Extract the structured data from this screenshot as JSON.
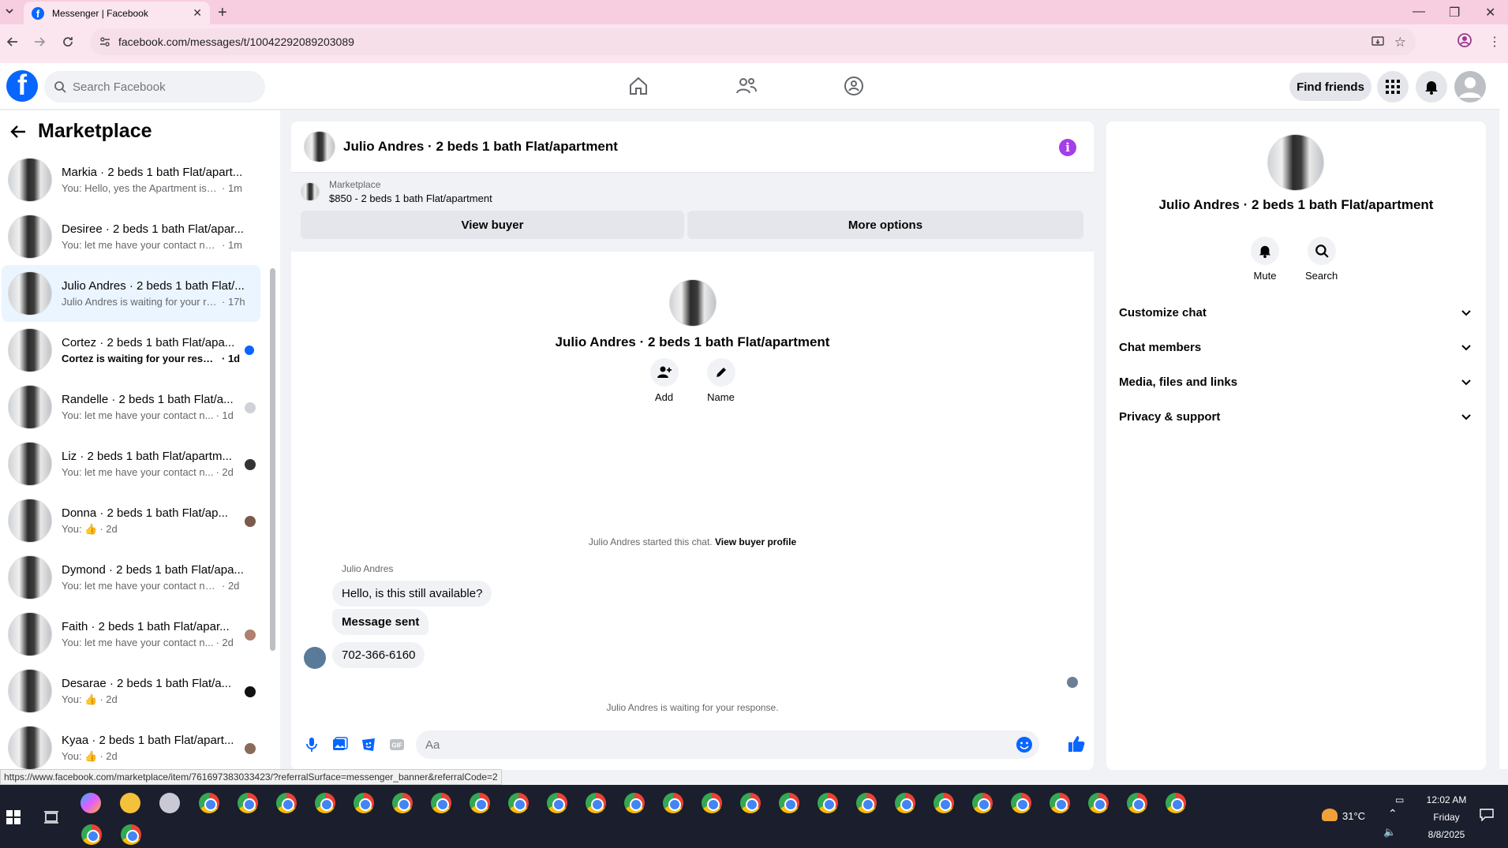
{
  "browser": {
    "tab_title": "Messenger | Facebook",
    "url": "facebook.com/messages/t/10042292089203089",
    "status_url": "https://www.facebook.com/marketplace/item/761697383033423/?referralSurface=messenger_banner&referralCode=2"
  },
  "fb_header": {
    "logo": "f",
    "search_placeholder": "Search Facebook",
    "find_friends": "Find friends"
  },
  "left_panel": {
    "title": "Marketplace",
    "conversations": [
      {
        "name": "Markia · 2 beds 1 bath Flat/apart...",
        "snippet": "You: Hello, yes the Apartment is sti...",
        "time": "· 1m",
        "mark": "none"
      },
      {
        "name": "Desiree · 2 beds 1 bath Flat/apar...",
        "snippet": "You: let me have your contact num...",
        "time": "· 1m",
        "mark": "none"
      },
      {
        "name": "Julio Andres · 2 beds 1 bath Flat/...",
        "snippet": "Julio Andres is waiting for your re...",
        "time": "· 17h",
        "mark": "none"
      },
      {
        "name": "Cortez · 2 beds 1 bath Flat/apa...",
        "snippet": "Cortez is waiting for your respo...",
        "time": "· 1d",
        "mark": "unread"
      },
      {
        "name": "Randelle · 2 beds 1 bath Flat/a...",
        "snippet": "You: let me have your contact n...",
        "time": "· 1d",
        "mark": "avatar"
      },
      {
        "name": "Liz · 2 beds 1 bath Flat/apartm...",
        "snippet": "You: let me have your contact n...",
        "time": "· 2d",
        "mark": "avatar"
      },
      {
        "name": "Donna · 2 beds 1 bath Flat/ap...",
        "snippet": "You: 👍",
        "time": "· 2d",
        "mark": "avatar"
      },
      {
        "name": "Dymond · 2 beds 1 bath Flat/apa...",
        "snippet": "You: let me have your contact num...",
        "time": "· 2d",
        "mark": "none"
      },
      {
        "name": "Faith · 2 beds 1 bath Flat/apar...",
        "snippet": "You: let me have your contact n...",
        "time": "· 2d",
        "mark": "avatar"
      },
      {
        "name": "Desarae · 2 beds 1 bath Flat/a...",
        "snippet": "You: 👍",
        "time": "· 2d",
        "mark": "avatar"
      },
      {
        "name": "Kyaa · 2 beds 1 bath Flat/apart...",
        "snippet": "You: 👍",
        "time": "· 2d",
        "mark": "avatar"
      }
    ]
  },
  "chat": {
    "title": "Julio Andres · 2 beds 1 bath Flat/apartment",
    "banner": {
      "label": "Marketplace",
      "price_line": "$850 - 2 beds 1 bath Flat/apartment",
      "view_buyer": "View buyer",
      "more_options": "More options"
    },
    "profile_name": "Julio Andres · 2 beds 1 bath Flat/apartment",
    "add_label": "Add",
    "name_label": "Name",
    "started_text": "Julio Andres started this chat.",
    "view_buyer_profile": "View buyer profile",
    "sender_name": "Julio Andres",
    "messages": [
      "Hello, is this still available?",
      "Message sent",
      "702-366-6160"
    ],
    "waiting_text": "Julio Andres is waiting for your response.",
    "composer_placeholder": "Aa"
  },
  "right_panel": {
    "name": "Julio Andres · 2 beds 1 bath Flat/apartment",
    "mute": "Mute",
    "search": "Search",
    "sections": [
      "Customize chat",
      "Chat members",
      "Media, files and links",
      "Privacy & support"
    ]
  },
  "taskbar": {
    "temp": "31°C",
    "time": "12:02 AM",
    "day": "Friday",
    "date": "8/8/2025"
  },
  "colors": {
    "fb_blue": "#0866ff",
    "active_conv": "#ebf5ff",
    "info_purple": "#a33ee8",
    "tab_pink": "#f7cde0"
  }
}
